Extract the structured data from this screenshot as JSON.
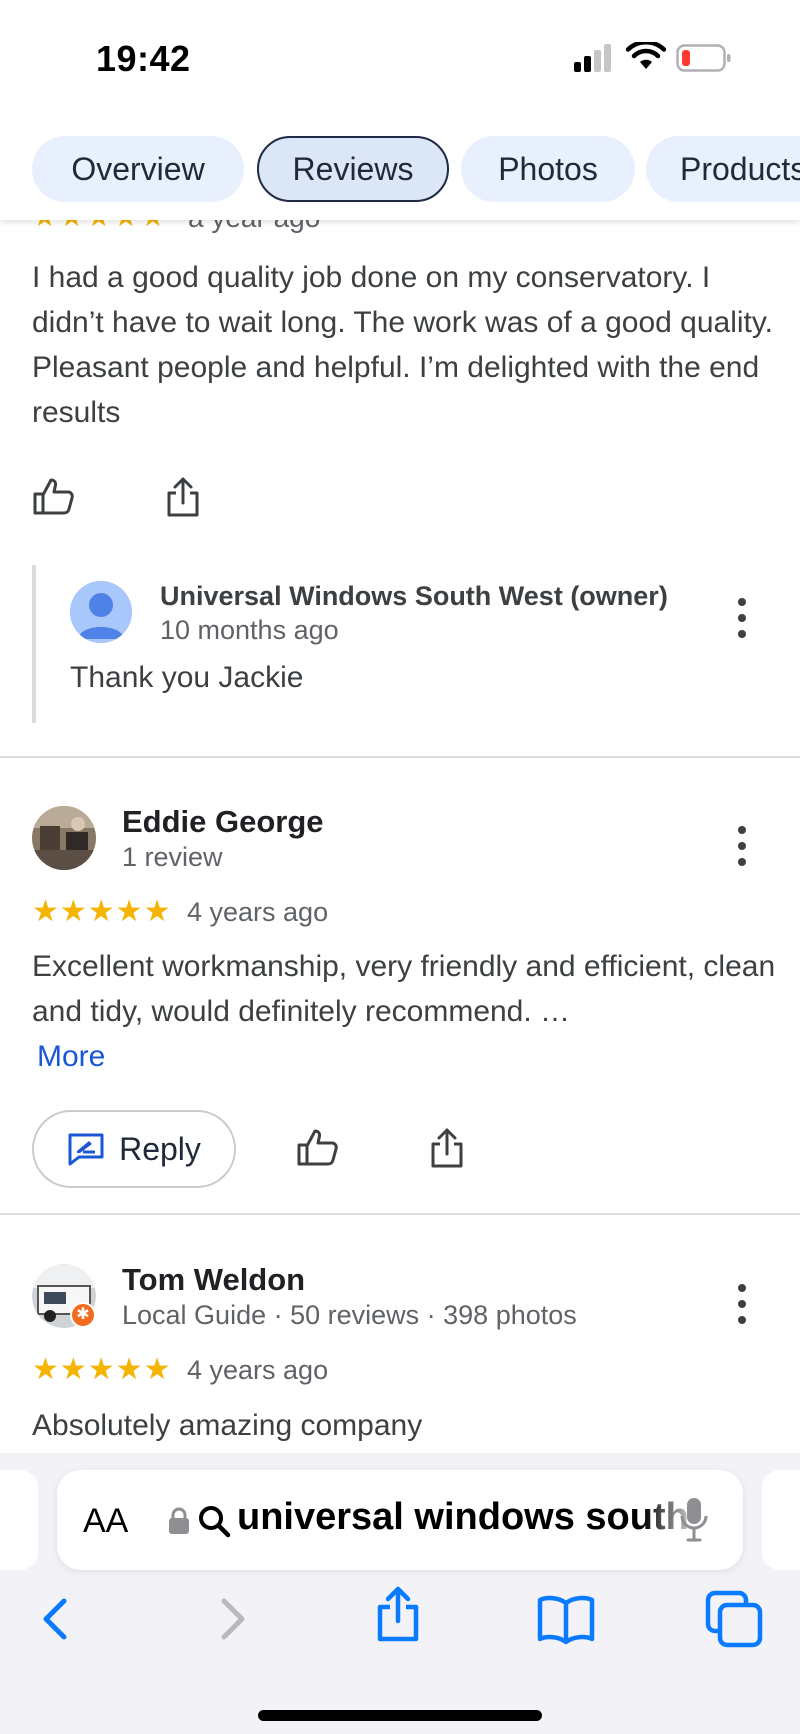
{
  "status_bar": {
    "time": "19:42"
  },
  "tabs": [
    {
      "label": "Overview",
      "active": false
    },
    {
      "label": "Reviews",
      "active": true
    },
    {
      "label": "Photos",
      "active": false
    },
    {
      "label": "Products",
      "active": false
    }
  ],
  "review_top": {
    "stars": "★★★★★",
    "rating": 5,
    "date": "a year ago",
    "text": "I had a good quality job done on my conservatory. I didn’t have to wait long. The work was of a good quality. Pleasant people and helpful. I’m delighted with the end results",
    "owner_reply": {
      "name": "Universal Windows South West (owner)",
      "date": "10 months ago",
      "text": "Thank you Jackie"
    }
  },
  "reviews": [
    {
      "name": "Eddie George",
      "meta": "1 review",
      "stars": "★★★★★",
      "rating": 5,
      "date": "4 years ago",
      "text": "Excellent workmanship, very friendly and efficient, clean and tidy, would definitely recommend. …",
      "more_label": "More",
      "reply_label": "Reply"
    },
    {
      "name": "Tom Weldon",
      "meta": "Local Guide · 50 reviews · 398 photos",
      "stars": "★★★★★",
      "rating": 5,
      "date": "4 years ago",
      "text": "Absolutely amazing company"
    }
  ],
  "browser": {
    "text_size_label": "AA",
    "url": "universal windows south west"
  },
  "colors": {
    "star": "#f4b400",
    "link": "#1a57d6",
    "ios_blue": "#0a7aff",
    "tab_bg": "#e8f0fe"
  },
  "icons": [
    "thumbs-up-icon",
    "share-icon",
    "more-vert-icon",
    "reply-icon",
    "lock-icon",
    "search-icon",
    "microphone-icon",
    "back-icon",
    "forward-icon",
    "bookmarks-icon",
    "tabs-icon"
  ]
}
